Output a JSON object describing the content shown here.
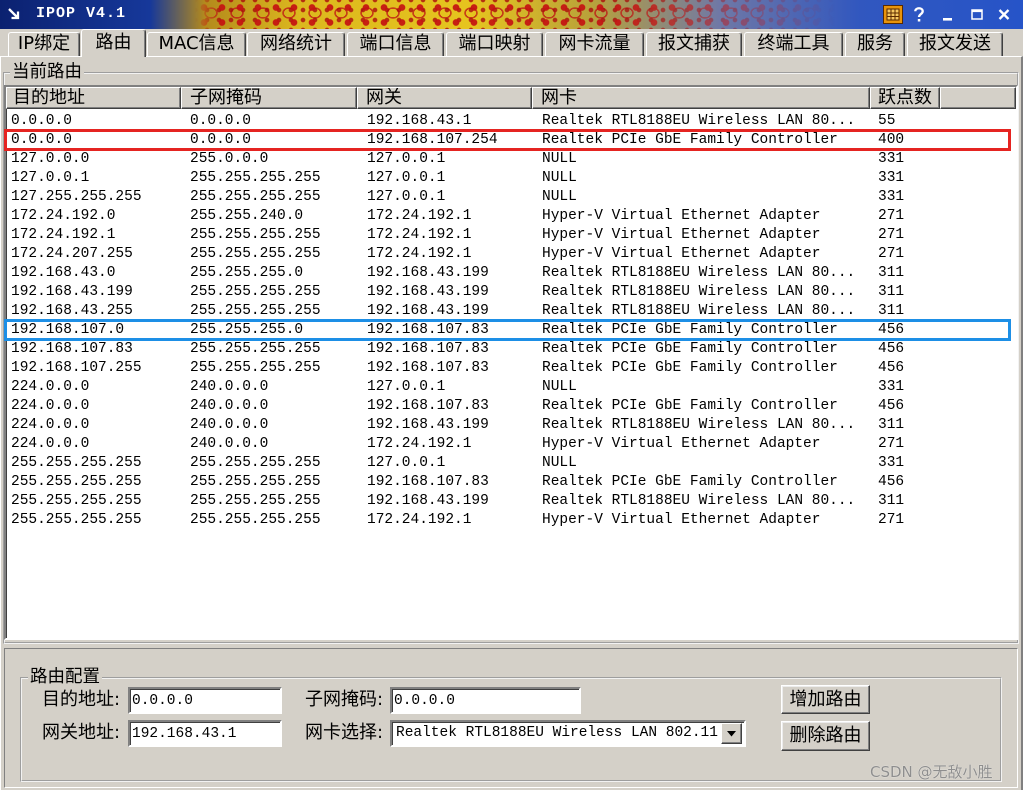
{
  "window": {
    "title": "IPOP V4.1"
  },
  "icons": {
    "system_menu": "arrow-icon",
    "tray": "app-tray-icon",
    "help": "help-icon",
    "minimize": "minimize-icon",
    "maximize": "maximize-icon",
    "close": "close-icon",
    "dropdown": "chevron-down-icon"
  },
  "tabs": [
    {
      "label": "IP绑定"
    },
    {
      "label": "路由",
      "selected": true
    },
    {
      "label": "MAC信息"
    },
    {
      "label": "网络统计"
    },
    {
      "label": "端口信息"
    },
    {
      "label": "端口映射"
    },
    {
      "label": "网卡流量"
    },
    {
      "label": "报文捕获"
    },
    {
      "label": "终端工具"
    },
    {
      "label": "服务"
    },
    {
      "label": "报文发送"
    }
  ],
  "route_list": {
    "group_label": "当前路由",
    "columns": [
      "目的地址",
      "子网掩码",
      "网关",
      "网卡",
      "跃点数"
    ],
    "rows": [
      {
        "dest": "0.0.0.0",
        "mask": "0.0.0.0",
        "gateway": "192.168.43.1",
        "nic": "Realtek RTL8188EU Wireless LAN 80...",
        "metric": 55
      },
      {
        "dest": "0.0.0.0",
        "mask": "0.0.0.0",
        "gateway": "192.168.107.254",
        "nic": "Realtek PCIe GbE Family Controller",
        "metric": 400,
        "outline_color": "#e52421"
      },
      {
        "dest": "127.0.0.0",
        "mask": "255.0.0.0",
        "gateway": "127.0.0.1",
        "nic": "NULL",
        "metric": 331
      },
      {
        "dest": "127.0.0.1",
        "mask": "255.255.255.255",
        "gateway": "127.0.0.1",
        "nic": "NULL",
        "metric": 331
      },
      {
        "dest": "127.255.255.255",
        "mask": "255.255.255.255",
        "gateway": "127.0.0.1",
        "nic": "NULL",
        "metric": 331
      },
      {
        "dest": "172.24.192.0",
        "mask": "255.255.240.0",
        "gateway": "172.24.192.1",
        "nic": "Hyper-V Virtual Ethernet Adapter",
        "metric": 271
      },
      {
        "dest": "172.24.192.1",
        "mask": "255.255.255.255",
        "gateway": "172.24.192.1",
        "nic": "Hyper-V Virtual Ethernet Adapter",
        "metric": 271
      },
      {
        "dest": "172.24.207.255",
        "mask": "255.255.255.255",
        "gateway": "172.24.192.1",
        "nic": "Hyper-V Virtual Ethernet Adapter",
        "metric": 271
      },
      {
        "dest": "192.168.43.0",
        "mask": "255.255.255.0",
        "gateway": "192.168.43.199",
        "nic": "Realtek RTL8188EU Wireless LAN 80...",
        "metric": 311
      },
      {
        "dest": "192.168.43.199",
        "mask": "255.255.255.255",
        "gateway": "192.168.43.199",
        "nic": "Realtek RTL8188EU Wireless LAN 80...",
        "metric": 311
      },
      {
        "dest": "192.168.43.255",
        "mask": "255.255.255.255",
        "gateway": "192.168.43.199",
        "nic": "Realtek RTL8188EU Wireless LAN 80...",
        "metric": 311
      },
      {
        "dest": "192.168.107.0",
        "mask": "255.255.255.0",
        "gateway": "192.168.107.83",
        "nic": "Realtek PCIe GbE Family Controller",
        "metric": 456,
        "outline_color": "#1d8fe6"
      },
      {
        "dest": "192.168.107.83",
        "mask": "255.255.255.255",
        "gateway": "192.168.107.83",
        "nic": "Realtek PCIe GbE Family Controller",
        "metric": 456
      },
      {
        "dest": "192.168.107.255",
        "mask": "255.255.255.255",
        "gateway": "192.168.107.83",
        "nic": "Realtek PCIe GbE Family Controller",
        "metric": 456
      },
      {
        "dest": "224.0.0.0",
        "mask": "240.0.0.0",
        "gateway": "127.0.0.1",
        "nic": "NULL",
        "metric": 331
      },
      {
        "dest": "224.0.0.0",
        "mask": "240.0.0.0",
        "gateway": "192.168.107.83",
        "nic": "Realtek PCIe GbE Family Controller",
        "metric": 456
      },
      {
        "dest": "224.0.0.0",
        "mask": "240.0.0.0",
        "gateway": "192.168.43.199",
        "nic": "Realtek RTL8188EU Wireless LAN 80...",
        "metric": 311
      },
      {
        "dest": "224.0.0.0",
        "mask": "240.0.0.0",
        "gateway": "172.24.192.1",
        "nic": "Hyper-V Virtual Ethernet Adapter",
        "metric": 271
      },
      {
        "dest": "255.255.255.255",
        "mask": "255.255.255.255",
        "gateway": "127.0.0.1",
        "nic": "NULL",
        "metric": 331
      },
      {
        "dest": "255.255.255.255",
        "mask": "255.255.255.255",
        "gateway": "192.168.107.83",
        "nic": "Realtek PCIe GbE Family Controller",
        "metric": 456
      },
      {
        "dest": "255.255.255.255",
        "mask": "255.255.255.255",
        "gateway": "192.168.43.199",
        "nic": "Realtek RTL8188EU Wireless LAN 80...",
        "metric": 311
      },
      {
        "dest": "255.255.255.255",
        "mask": "255.255.255.255",
        "gateway": "172.24.192.1",
        "nic": "Hyper-V Virtual Ethernet Adapter",
        "metric": 271
      }
    ]
  },
  "route_config": {
    "group_label": "路由配置",
    "dest_label": "目的地址:",
    "dest_value": "0.0.0.0",
    "mask_label": "子网掩码:",
    "mask_value": "0.0.0.0",
    "gateway_label": "网关地址:",
    "gateway_value": "192.168.43.1",
    "nic_label": "网卡选择:",
    "nic_value": "Realtek RTL8188EU Wireless LAN 802.11",
    "add_button": "增加路由",
    "delete_button": "删除路由"
  },
  "watermark": "CSDN @无敌小胜",
  "colors": {
    "window_bg": "#d4d0c8",
    "title_bar": "#0b2170",
    "highlight_red": "#e52421",
    "highlight_blue": "#1d8fe6",
    "watermark": "#8e8e8e"
  }
}
